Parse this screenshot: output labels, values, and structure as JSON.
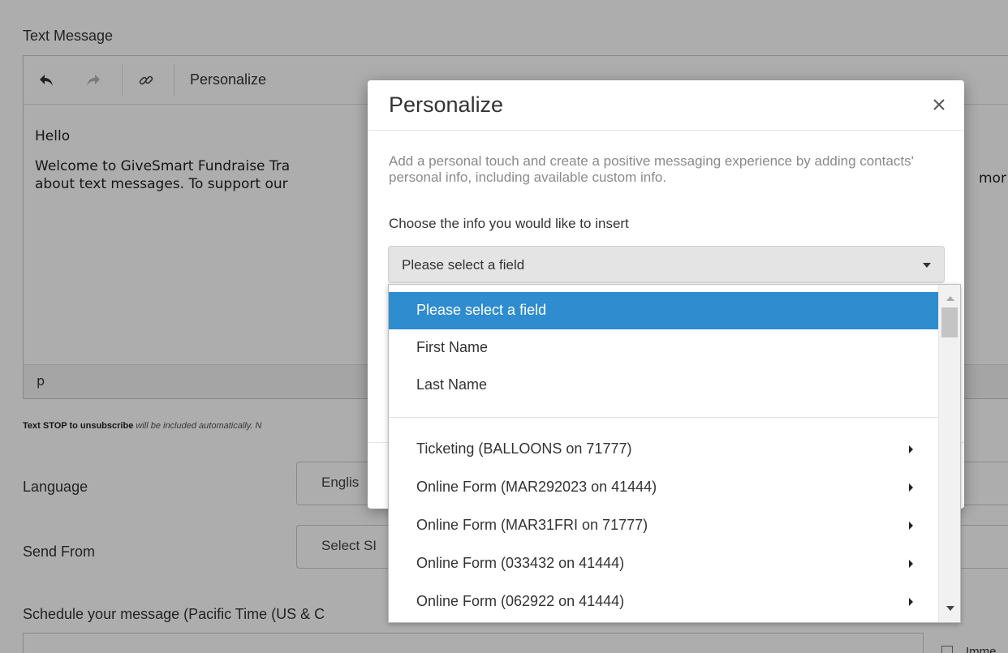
{
  "background": {
    "text_message_label": "Text Message",
    "toolbar": {
      "personalize_label": "Personalize"
    },
    "editor": {
      "line1": "Hello",
      "line2a": "Welcome to GiveSmart Fundraise Tra",
      "line2b": "about text messages. To support our",
      "overflow_text": "mor",
      "status_path": "p"
    },
    "note": {
      "bold": "Text STOP to unsubscribe",
      "italic": "will be included automatically. N"
    },
    "language_label": "Language",
    "language_value": "Englis",
    "send_from_label": "Send From",
    "send_from_value": "Select SI",
    "schedule_label": "Schedule your message (Pacific Time (US & C",
    "immediate_label": "Imme"
  },
  "modal": {
    "title": "Personalize",
    "description": "Add a personal touch and create a positive messaging experience by adding contacts' personal info, including available custom info.",
    "prompt": "Choose the info you would like to insert",
    "select_value": "Please select a field"
  },
  "dropdown": {
    "selected_index": 0,
    "top_items": [
      "Please select a field",
      "First Name",
      "Last Name"
    ],
    "group_items": [
      "Ticketing (BALLOONS on 71777)",
      "Online Form (MAR292023 on 41444)",
      "Online Form (MAR31FRI on 71777)",
      "Online Form (033432 on 41444)",
      "Online Form (062922 on 41444)"
    ]
  },
  "colors": {
    "selected_bg": "#2e8ccf",
    "overlay": "rgba(0,0,0,0.32)"
  }
}
